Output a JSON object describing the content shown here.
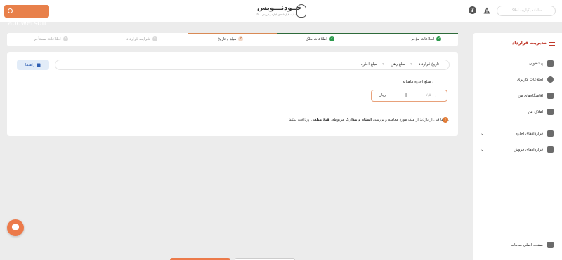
{
  "watermark": "apowersoft",
  "header": {
    "logo_title": "خــودنـــویس",
    "logo_subtitle": "سامانه ثبت قراردادهای اجاره و فروش املاک",
    "user_placeholder": "سامانه یکپارچه املاک"
  },
  "stepper": {
    "steps": [
      {
        "label": "اطلاعات مؤجر",
        "state": "done",
        "badge": "✓"
      },
      {
        "label": "اطلاعات ملک",
        "state": "done",
        "badge": "✓"
      },
      {
        "label": "مبلغ و تاریخ",
        "state": "active",
        "badge": "۳"
      },
      {
        "label": "شرایط قرارداد",
        "state": "todo",
        "badge": "۴"
      },
      {
        "label": "اطلاعات مستأجر",
        "state": "todo",
        "badge": "۵"
      }
    ]
  },
  "main": {
    "guide_label": "راهنما",
    "breadcrumb": [
      "تاریخ قرارداد",
      "مبلغ رهن",
      "مبلغ اجاره"
    ],
    "field_label": "مبلغ اجاره ماهیانه :",
    "input_placeholder": "۷,۵۰۰,۰۰۰",
    "input_unit": "ریال",
    "notice_pre": "لطفا قبل از بازدید از ملک مورد معامله و بررسی",
    "notice_bold1": "اسناد و مدارک",
    "notice_mid": "مربوطه،",
    "notice_bold2": "هیچ مبلغی",
    "notice_post": "پرداخت نکنید.",
    "notice_icon": "!"
  },
  "sidebar": {
    "title": "مدیریت قرارداد",
    "items": [
      {
        "label": "پیشخوان",
        "icon": "dashboard-icon"
      },
      {
        "label": "اطلاعات کاربری",
        "icon": "user-icon"
      },
      {
        "label": "اقامتگاه‌های من",
        "icon": "building-icon"
      },
      {
        "label": "املاک من",
        "icon": "home-icon"
      },
      {
        "label": "قراردادهای اجاره",
        "icon": "clipboard-icon"
      },
      {
        "label": "قراردادهای فروش",
        "icon": "clipboard-icon"
      }
    ],
    "footer_link": "صفحه اصلی سامانه"
  },
  "colors": {
    "accent": "#ec7a4a",
    "done": "#2e9b4e",
    "sidebar_title": "#c0392b",
    "guide_text": "#2f5fb3"
  }
}
